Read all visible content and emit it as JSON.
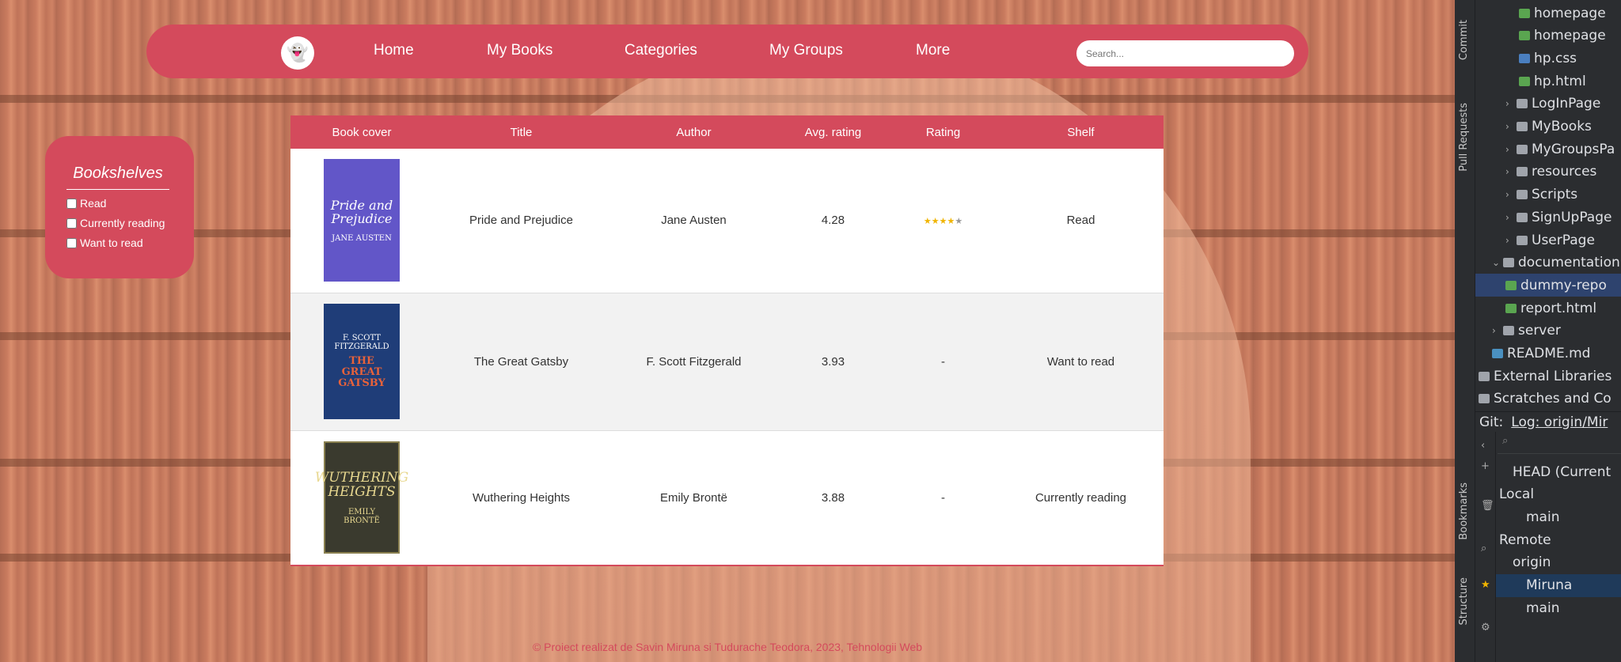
{
  "site": {
    "logo_icon": "ghost-logo-icon",
    "nav": [
      "Home",
      "My Books",
      "Categories",
      "My Groups",
      "More"
    ],
    "search_placeholder": "Search...",
    "bookshelves": {
      "title": "Bookshelves",
      "items": [
        "Read",
        "Currently reading",
        "Want to read"
      ]
    },
    "table": {
      "headers": [
        "Book cover",
        "Title",
        "Author",
        "Avg. rating",
        "Rating",
        "Shelf"
      ],
      "rows": [
        {
          "cover_title": "Pride and Prejudice",
          "cover_author": "JANE AUSTEN",
          "title": "Pride and Prejudice",
          "author": "Jane Austen",
          "avg": "4.28",
          "rating": 4,
          "rating_text": "",
          "shelf": "Read"
        },
        {
          "cover_title": "THE GREAT GATSBY",
          "cover_author": "F. SCOTT FITZGERALD",
          "title": "The Great Gatsby",
          "author": "F. Scott Fitzgerald",
          "avg": "3.93",
          "rating": 0,
          "rating_text": "-",
          "shelf": "Want to read"
        },
        {
          "cover_title": "WUTHERING HEIGHTS",
          "cover_author": "EMILY BRONTË",
          "title": "Wuthering Heights",
          "author": "Emily Brontë",
          "avg": "3.88",
          "rating": 0,
          "rating_text": "-",
          "shelf": "Currently reading"
        }
      ]
    },
    "footer": "© Proiect realizat de Savin Miruna si Tudurache Teodora, 2023, Tehnologii Web",
    "accent_color": "#d44a5c"
  },
  "ide": {
    "side_tabs": [
      "Commit",
      "Pull Requests",
      "Bookmarks",
      "Structure"
    ],
    "tree": [
      {
        "label": "homepage",
        "icon": "html-file-icon",
        "indent": 3
      },
      {
        "label": "homepage",
        "icon": "html-file-icon",
        "indent": 3
      },
      {
        "label": "hp.css",
        "icon": "css-file-icon",
        "indent": 3
      },
      {
        "label": "hp.html",
        "icon": "html-file-icon",
        "indent": 3
      },
      {
        "label": "LogInPage",
        "icon": "folder-icon",
        "indent": 2
      },
      {
        "label": "MyBooks",
        "icon": "folder-icon",
        "indent": 2
      },
      {
        "label": "MyGroupsPa",
        "icon": "folder-icon",
        "indent": 2
      },
      {
        "label": "resources",
        "icon": "folder-icon",
        "indent": 2
      },
      {
        "label": "Scripts",
        "icon": "folder-icon",
        "indent": 2
      },
      {
        "label": "SignUpPage",
        "icon": "folder-icon",
        "indent": 2
      },
      {
        "label": "UserPage",
        "icon": "folder-icon",
        "indent": 2
      },
      {
        "label": "documentation",
        "icon": "folder-icon",
        "indent": 1
      },
      {
        "label": "dummy-repo",
        "icon": "html-file-icon",
        "indent": 2
      },
      {
        "label": "report.html",
        "icon": "html-file-icon",
        "indent": 2
      },
      {
        "label": "server",
        "icon": "folder-icon",
        "indent": 1
      },
      {
        "label": "README.md",
        "icon": "md-file-icon",
        "indent": 1
      },
      {
        "label": "External Libraries",
        "icon": "library-icon",
        "indent": 0
      },
      {
        "label": "Scratches and Co",
        "icon": "scratch-icon",
        "indent": 0
      }
    ],
    "git_title": "Git:",
    "git_log": "Log: origin/Mir",
    "git_tree": [
      {
        "label": "HEAD (Current",
        "indent": 1
      },
      {
        "label": "Local",
        "indent": 0
      },
      {
        "label": "main",
        "indent": 2
      },
      {
        "label": "Remote",
        "indent": 0
      },
      {
        "label": "origin",
        "indent": 1
      },
      {
        "label": "Miruna",
        "indent": 2
      },
      {
        "label": "main",
        "indent": 2
      }
    ]
  }
}
